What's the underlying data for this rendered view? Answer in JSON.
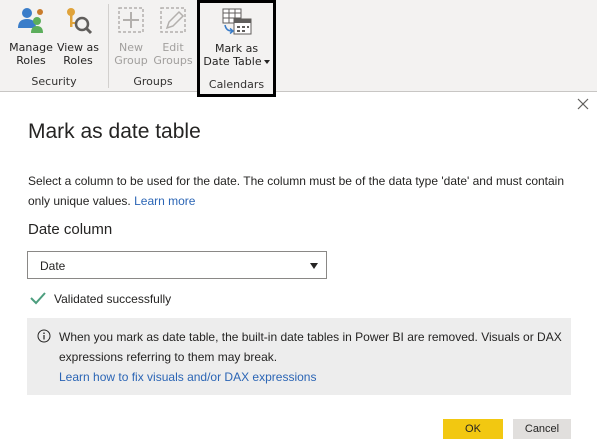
{
  "ribbon": {
    "security": {
      "label": "Security",
      "manage_roles": "Manage Roles",
      "view_as_roles": "View as Roles"
    },
    "groups": {
      "label": "Groups",
      "new_group": "New Group",
      "edit_groups": "Edit Groups"
    },
    "calendars": {
      "label": "Calendars",
      "mark_as_date_table_line1": "Mark as",
      "mark_as_date_table_line2": "Date Table"
    }
  },
  "dialog": {
    "title": "Mark as date table",
    "description": "Select a column to be used for the date. The column must be of the data type 'date' and must contain only unique values.",
    "learn_more": "Learn more",
    "date_column_label": "Date column",
    "date_column_value": "Date",
    "validation_text": "Validated successfully",
    "info_text": "When you mark as date table, the built-in date tables in Power BI are removed. Visuals or DAX expressions referring to them may break.",
    "info_link": "Learn how to fix visuals and/or DAX expressions",
    "ok_label": "OK",
    "cancel_label": "Cancel"
  },
  "colors": {
    "accent_ok": "#f2c811",
    "link": "#2b65b5",
    "success": "#4c9e7e",
    "info_bg": "#ededed"
  },
  "icons": [
    "manage-roles-icon",
    "view-as-roles-icon",
    "new-group-icon",
    "edit-groups-icon",
    "mark-as-date-table-icon",
    "close-icon",
    "check-icon",
    "info-icon",
    "dropdown-arrow-icon"
  ]
}
